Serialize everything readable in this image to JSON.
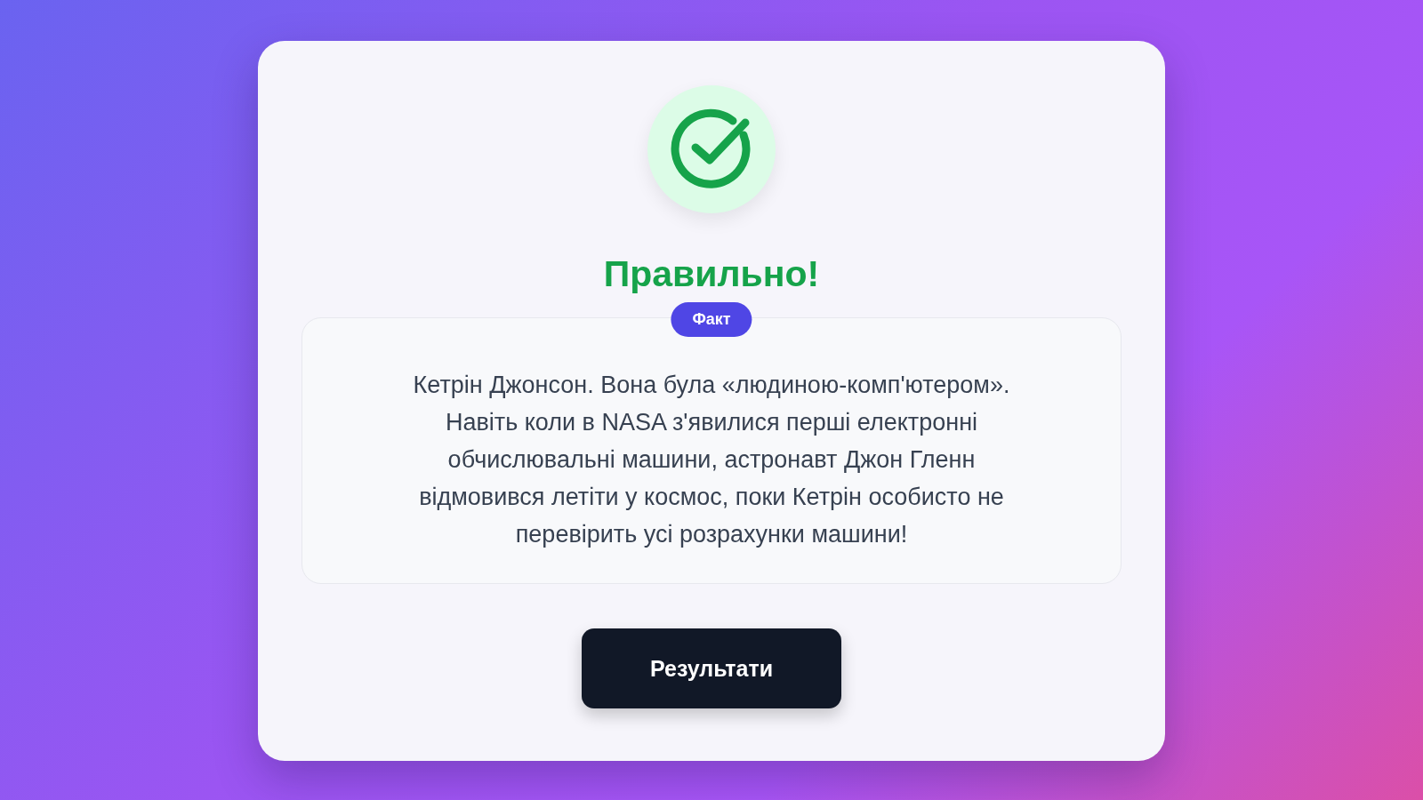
{
  "result": {
    "kind": "correct",
    "title": "Правильно!"
  },
  "fact": {
    "badge": "Факт",
    "text": "Кетрін Джонсон. Вона була «людиною-комп'ютером». Навіть коли в NASA з'явилися перші електронні обчислювальні машини, астронавт Джон Гленн відмовився летіти у космос, поки Кетрін особисто не перевірить усі розрахунки машини!"
  },
  "button": {
    "label": "Результати"
  }
}
